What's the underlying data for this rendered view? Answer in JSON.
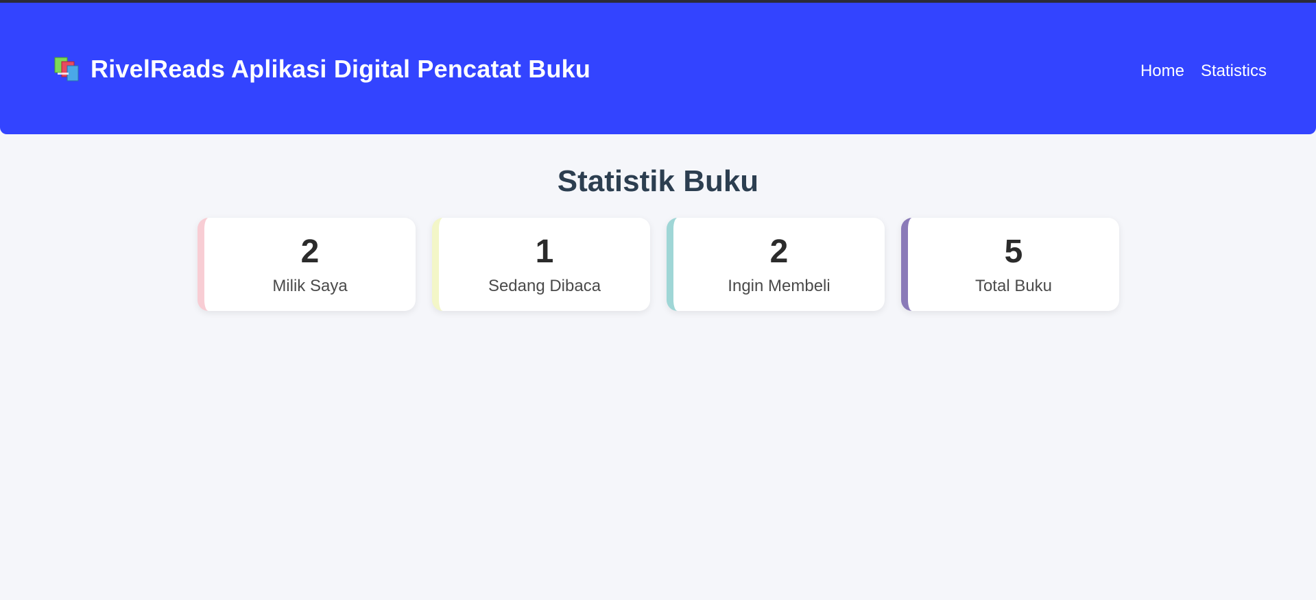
{
  "header": {
    "brand_title": "RivelReads Aplikasi Digital Pencatat Buku",
    "brand_icon": "books-icon",
    "background_color": "#3344ff",
    "nav": [
      {
        "label": "Home"
      },
      {
        "label": "Statistics"
      }
    ]
  },
  "main": {
    "title": "Statistik Buku",
    "cards": [
      {
        "count": "2",
        "label": "Milik Saya",
        "accent": "#f8cdd4"
      },
      {
        "count": "1",
        "label": "Sedang Dibaca",
        "accent": "#f3f6c8"
      },
      {
        "count": "2",
        "label": "Ingin Membeli",
        "accent": "#9fd6d6"
      },
      {
        "count": "5",
        "label": "Total Buku",
        "accent": "#8a7ab8"
      }
    ]
  }
}
